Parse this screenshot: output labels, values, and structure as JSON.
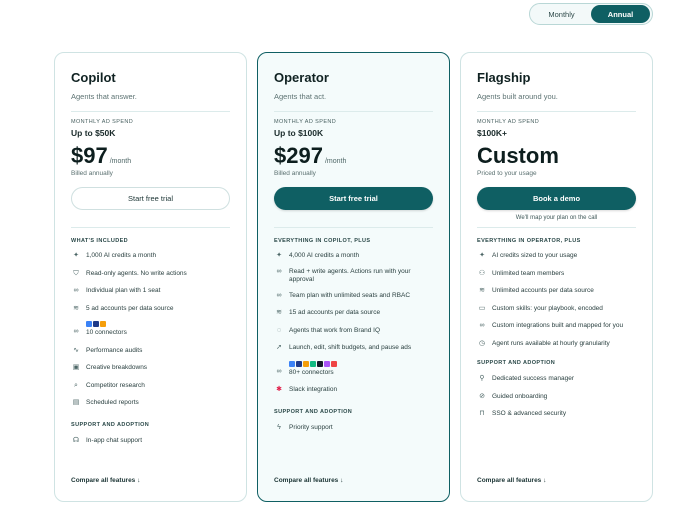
{
  "billing_toggle": {
    "monthly": "Monthly",
    "annual": "Annual"
  },
  "plans": [
    {
      "name": "Copilot",
      "tagline": "Agents that answer.",
      "spend_label": "MONTHLY AD SPEND",
      "spend": "Up to $50K",
      "price": "$97",
      "per": "/month",
      "billed": "Billed annually",
      "cta": "Start free trial",
      "section1": "WHAT'S INCLUDED",
      "features": [
        "1,000 AI credits a month",
        "Read-only agents. No write actions",
        "Individual plan with 1 seat",
        "5 ad accounts per data source",
        "10 connectors",
        "Performance audits",
        "Creative breakdowns",
        "Competitor research",
        "Scheduled reports"
      ],
      "section2": "SUPPORT AND ADOPTION",
      "support": [
        "In-app chat support"
      ],
      "compare": "Compare all features ↓"
    },
    {
      "name": "Operator",
      "tagline": "Agents that act.",
      "spend_label": "MONTHLY AD SPEND",
      "spend": "Up to $100K",
      "price": "$297",
      "per": "/month",
      "billed": "Billed annually",
      "cta": "Start free trial",
      "section1": "EVERYTHING IN COPILOT, PLUS",
      "features": [
        "4,000 AI credits a month",
        "Read + write agents. Actions run with your approval",
        "Team plan with unlimited seats and RBAC",
        "15 ad accounts per data source",
        "Agents that work from Brand IQ",
        "Launch, edit, shift budgets, and pause ads",
        "80+ connectors",
        "Slack integration"
      ],
      "section2": "SUPPORT AND ADOPTION",
      "support": [
        "Priority support"
      ],
      "compare": "Compare all features ↓"
    },
    {
      "name": "Flagship",
      "tagline": "Agents built around you.",
      "spend_label": "MONTHLY AD SPEND",
      "spend": "$100K+",
      "price": "Custom",
      "billed": "Priced to your usage",
      "cta": "Book a demo",
      "cta_note": "We'll map your plan on the call",
      "section1": "EVERYTHING IN OPERATOR, PLUS",
      "features": [
        "AI credits sized to your usage",
        "Unlimited team members",
        "Unlimited accounts per data source",
        "Custom skills: your playbook, encoded",
        "Custom integrations built and mapped for you",
        "Agent runs available at hourly granularity"
      ],
      "section2": "SUPPORT AND ADOPTION",
      "support": [
        "Dedicated success manager",
        "Guided onboarding",
        "SSO & advanced security"
      ],
      "compare": "Compare all features ↓"
    }
  ],
  "colors": {
    "accent": "#0f5f63",
    "border": "#cfe3e3",
    "featured_bg": "#f4fbfb"
  }
}
